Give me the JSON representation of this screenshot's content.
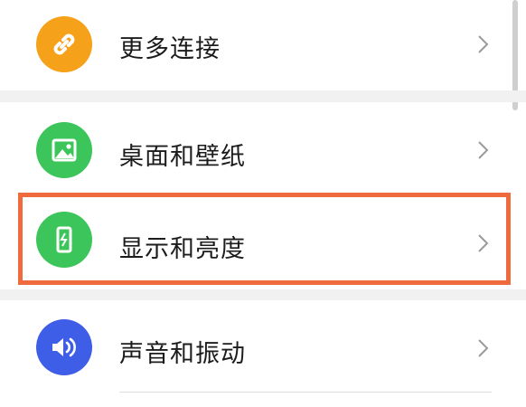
{
  "settings": {
    "items": [
      {
        "label": "更多连接",
        "icon": "link-icon",
        "color": "#f6a11a"
      },
      {
        "label": "桌面和壁纸",
        "icon": "wallpaper-icon",
        "color": "#3cc55a"
      },
      {
        "label": "显示和亮度",
        "icon": "display-brightness-icon",
        "color": "#3cc55a",
        "highlighted": true
      },
      {
        "label": "声音和振动",
        "icon": "speaker-icon",
        "color": "#3f5ee8"
      }
    ]
  },
  "colors": {
    "highlight_border": "#ef6a3c",
    "section_separator": "#f1f1f1"
  }
}
